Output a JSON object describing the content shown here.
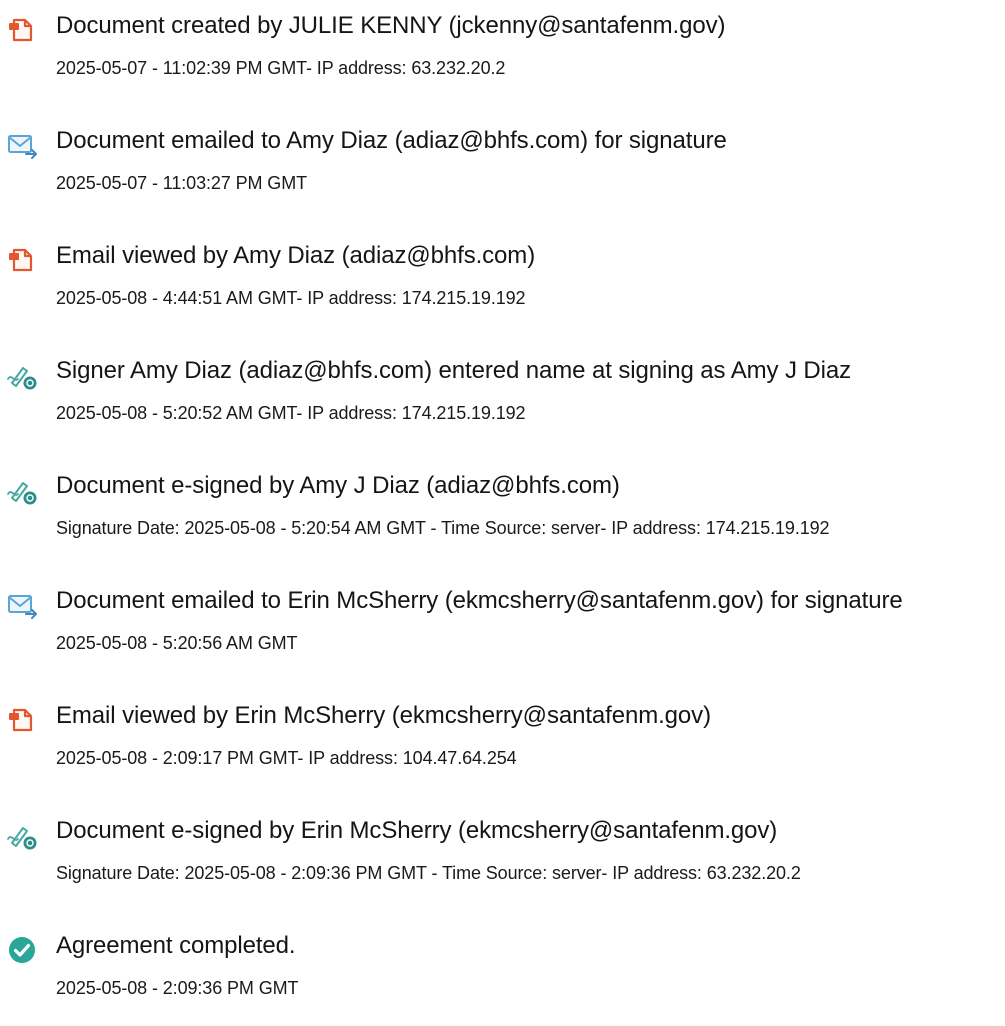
{
  "colors": {
    "document_icon": "#e4572e",
    "email_icon": "#5aa5d6",
    "signer_icon": "#46a8a0",
    "completed_icon": "#2aa59a"
  },
  "entries": [
    {
      "icon": "document-icon",
      "title": "Document created by JULIE KENNY (jckenny@santafenm.gov)",
      "detail": "2025-05-07 - 11:02:39 PM GMT- IP address: 63.232.20.2"
    },
    {
      "icon": "email-icon",
      "title": "Document emailed to Amy Diaz (adiaz@bhfs.com) for signature",
      "detail": "2025-05-07 - 11:03:27 PM GMT"
    },
    {
      "icon": "document-icon",
      "title": "Email viewed by Amy Diaz (adiaz@bhfs.com)",
      "detail": "2025-05-08 - 4:44:51 AM GMT- IP address: 174.215.19.192"
    },
    {
      "icon": "signature-pen-icon",
      "title": "Signer Amy Diaz (adiaz@bhfs.com) entered name at signing as Amy J Diaz",
      "detail": "2025-05-08 - 5:20:52 AM GMT- IP address: 174.215.19.192"
    },
    {
      "icon": "signature-pen-icon",
      "title": "Document e-signed by Amy J Diaz (adiaz@bhfs.com)",
      "detail": "Signature Date: 2025-05-08 - 5:20:54 AM GMT - Time Source: server- IP address: 174.215.19.192"
    },
    {
      "icon": "email-icon",
      "title": "Document emailed to Erin McSherry (ekmcsherry@santafenm.gov) for signature",
      "detail": "2025-05-08 - 5:20:56 AM GMT"
    },
    {
      "icon": "document-icon",
      "title": "Email viewed by Erin McSherry (ekmcsherry@santafenm.gov)",
      "detail": "2025-05-08 - 2:09:17 PM GMT- IP address: 104.47.64.254"
    },
    {
      "icon": "signature-pen-icon",
      "title": "Document e-signed by Erin McSherry (ekmcsherry@santafenm.gov)",
      "detail": "Signature Date: 2025-05-08 - 2:09:36 PM GMT - Time Source: server- IP address: 63.232.20.2"
    },
    {
      "icon": "check-circle-icon",
      "title": "Agreement completed.",
      "detail": "2025-05-08 - 2:09:36 PM GMT"
    }
  ]
}
